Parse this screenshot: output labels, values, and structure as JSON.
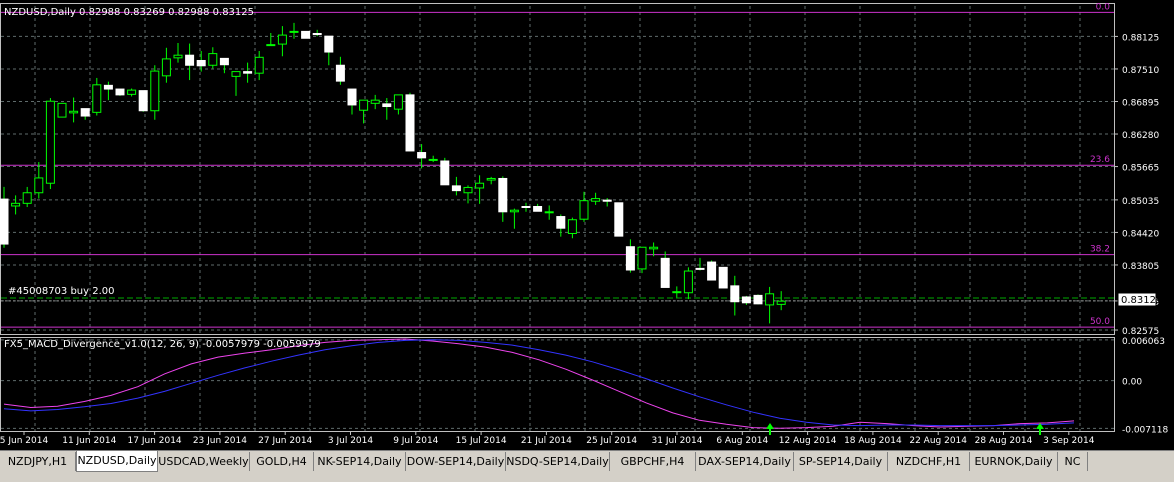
{
  "window": {
    "chart_title": "NZDUSD,Daily  0.82988 0.83269 0.82988 0.83125",
    "indicator_title": "FX5_MACD_Divergence_v1.0(12, 26, 9) -0.0057979 -0.0059979",
    "order_label": "#45008703 buy 2.00",
    "current_price": "0.83125"
  },
  "colors": {
    "background": "#000000",
    "grid": "#5f6b6b",
    "bull": "#00ff00",
    "bear": "#ffffff",
    "fib": "#cc33cc",
    "macd_main": "#ee44ee",
    "macd_signal": "#3333ff",
    "axis_text": "#ffffff"
  },
  "chart_data": [
    {
      "type": "candlestick",
      "title": "NZDUSD,Daily",
      "ylim": [
        0.825,
        0.887
      ],
      "y_ticks": [
        "0.88125",
        "0.87510",
        "0.86895",
        "0.86280",
        "0.85665",
        "0.85035",
        "0.84420",
        "0.83805",
        "0.83125",
        "0.82575"
      ],
      "x_ticks": [
        "5 Jun 2014",
        "11 Jun 2014",
        "17 Jun 2014",
        "23 Jun 2014",
        "27 Jun 2014",
        "3 Jul 2014",
        "9 Jul 2014",
        "15 Jul 2014",
        "21 Jul 2014",
        "25 Jul 2014",
        "31 Jul 2014",
        "6 Aug 2014",
        "12 Aug 2014",
        "18 Aug 2014",
        "22 Aug 2014",
        "28 Aug 2014",
        "3 Sep 2014"
      ],
      "fib_levels": [
        {
          "label": "0.0",
          "price": 0.8858
        },
        {
          "label": "23.6",
          "price": 0.8569
        },
        {
          "label": "38.2",
          "price": 0.84
        },
        {
          "label": "50.0",
          "price": 0.8263
        }
      ],
      "order_price": 0.8318,
      "current_price": 0.83125,
      "candles": [
        {
          "o": 0.8505,
          "h": 0.8528,
          "l": 0.8413,
          "c": 0.842
        },
        {
          "o": 0.8492,
          "h": 0.8512,
          "l": 0.8476,
          "c": 0.8497
        },
        {
          "o": 0.8497,
          "h": 0.8528,
          "l": 0.849,
          "c": 0.8517
        },
        {
          "o": 0.8517,
          "h": 0.8575,
          "l": 0.8506,
          "c": 0.8545
        },
        {
          "o": 0.8535,
          "h": 0.8696,
          "l": 0.8524,
          "c": 0.869
        },
        {
          "o": 0.866,
          "h": 0.8687,
          "l": 0.866,
          "c": 0.8686
        },
        {
          "o": 0.8668,
          "h": 0.8697,
          "l": 0.865,
          "c": 0.8671
        },
        {
          "o": 0.8676,
          "h": 0.8676,
          "l": 0.8655,
          "c": 0.8662
        },
        {
          "o": 0.8669,
          "h": 0.8734,
          "l": 0.8663,
          "c": 0.8721
        },
        {
          "o": 0.872,
          "h": 0.8727,
          "l": 0.8692,
          "c": 0.8713
        },
        {
          "o": 0.8713,
          "h": 0.8713,
          "l": 0.87,
          "c": 0.8702
        },
        {
          "o": 0.8703,
          "h": 0.8714,
          "l": 0.8699,
          "c": 0.8711
        },
        {
          "o": 0.871,
          "h": 0.8706,
          "l": 0.867,
          "c": 0.8672
        },
        {
          "o": 0.8672,
          "h": 0.8758,
          "l": 0.8655,
          "c": 0.8747
        },
        {
          "o": 0.8738,
          "h": 0.8791,
          "l": 0.8725,
          "c": 0.877
        },
        {
          "o": 0.8772,
          "h": 0.88,
          "l": 0.8763,
          "c": 0.8777
        },
        {
          "o": 0.8777,
          "h": 0.8799,
          "l": 0.873,
          "c": 0.8758
        },
        {
          "o": 0.8767,
          "h": 0.8785,
          "l": 0.8746,
          "c": 0.8757
        },
        {
          "o": 0.8758,
          "h": 0.8792,
          "l": 0.8752,
          "c": 0.878
        },
        {
          "o": 0.8771,
          "h": 0.8771,
          "l": 0.8743,
          "c": 0.8759
        },
        {
          "o": 0.8737,
          "h": 0.8742,
          "l": 0.87,
          "c": 0.8746
        },
        {
          "o": 0.8746,
          "h": 0.8763,
          "l": 0.8725,
          "c": 0.8743
        },
        {
          "o": 0.8743,
          "h": 0.8785,
          "l": 0.873,
          "c": 0.8773
        },
        {
          "o": 0.8797,
          "h": 0.8819,
          "l": 0.8797,
          "c": 0.8797
        },
        {
          "o": 0.8798,
          "h": 0.8832,
          "l": 0.8775,
          "c": 0.8815
        },
        {
          "o": 0.8821,
          "h": 0.8838,
          "l": 0.8808,
          "c": 0.8822
        },
        {
          "o": 0.8822,
          "h": 0.8822,
          "l": 0.8809,
          "c": 0.8809
        },
        {
          "o": 0.8818,
          "h": 0.8825,
          "l": 0.8813,
          "c": 0.8816
        },
        {
          "o": 0.8813,
          "h": 0.8813,
          "l": 0.8758,
          "c": 0.8783
        },
        {
          "o": 0.8758,
          "h": 0.8774,
          "l": 0.8721,
          "c": 0.8728
        },
        {
          "o": 0.8713,
          "h": 0.8713,
          "l": 0.8665,
          "c": 0.8683
        },
        {
          "o": 0.8673,
          "h": 0.8689,
          "l": 0.8648,
          "c": 0.8692
        },
        {
          "o": 0.8686,
          "h": 0.8702,
          "l": 0.8675,
          "c": 0.8692
        },
        {
          "o": 0.8685,
          "h": 0.8696,
          "l": 0.8655,
          "c": 0.868
        },
        {
          "o": 0.8675,
          "h": 0.87,
          "l": 0.8665,
          "c": 0.8702
        },
        {
          "o": 0.8702,
          "h": 0.8706,
          "l": 0.8595,
          "c": 0.8596
        },
        {
          "o": 0.8593,
          "h": 0.8609,
          "l": 0.8563,
          "c": 0.8583
        },
        {
          "o": 0.858,
          "h": 0.8587,
          "l": 0.8575,
          "c": 0.858
        },
        {
          "o": 0.8577,
          "h": 0.8583,
          "l": 0.8533,
          "c": 0.8532
        },
        {
          "o": 0.853,
          "h": 0.8547,
          "l": 0.8512,
          "c": 0.8521
        },
        {
          "o": 0.8517,
          "h": 0.8531,
          "l": 0.8497,
          "c": 0.8527
        },
        {
          "o": 0.8526,
          "h": 0.855,
          "l": 0.8496,
          "c": 0.8535
        },
        {
          "o": 0.8541,
          "h": 0.8547,
          "l": 0.8533,
          "c": 0.8544
        },
        {
          "o": 0.8544,
          "h": 0.8548,
          "l": 0.8462,
          "c": 0.8481
        },
        {
          "o": 0.8481,
          "h": 0.8487,
          "l": 0.8449,
          "c": 0.8484
        },
        {
          "o": 0.8491,
          "h": 0.8498,
          "l": 0.8481,
          "c": 0.849
        },
        {
          "o": 0.8491,
          "h": 0.8496,
          "l": 0.8482,
          "c": 0.8482
        },
        {
          "o": 0.848,
          "h": 0.8493,
          "l": 0.8466,
          "c": 0.8481
        },
        {
          "o": 0.8472,
          "h": 0.8476,
          "l": 0.8434,
          "c": 0.845
        },
        {
          "o": 0.844,
          "h": 0.847,
          "l": 0.8431,
          "c": 0.8466
        },
        {
          "o": 0.8467,
          "h": 0.8519,
          "l": 0.8462,
          "c": 0.8502
        },
        {
          "o": 0.8501,
          "h": 0.8517,
          "l": 0.8494,
          "c": 0.8506
        },
        {
          "o": 0.8503,
          "h": 0.8507,
          "l": 0.8491,
          "c": 0.8501
        },
        {
          "o": 0.8498,
          "h": 0.8496,
          "l": 0.8435,
          "c": 0.8435
        },
        {
          "o": 0.8415,
          "h": 0.8429,
          "l": 0.8366,
          "c": 0.8371
        },
        {
          "o": 0.8373,
          "h": 0.8411,
          "l": 0.8365,
          "c": 0.8414
        },
        {
          "o": 0.8411,
          "h": 0.8423,
          "l": 0.8397,
          "c": 0.8414
        },
        {
          "o": 0.8393,
          "h": 0.8406,
          "l": 0.8339,
          "c": 0.8338
        },
        {
          "o": 0.833,
          "h": 0.834,
          "l": 0.8319,
          "c": 0.833
        },
        {
          "o": 0.8328,
          "h": 0.8376,
          "l": 0.8316,
          "c": 0.8369
        },
        {
          "o": 0.8374,
          "h": 0.8394,
          "l": 0.837,
          "c": 0.8373
        },
        {
          "o": 0.8386,
          "h": 0.8389,
          "l": 0.8365,
          "c": 0.8352
        },
        {
          "o": 0.8376,
          "h": 0.8376,
          "l": 0.8339,
          "c": 0.8337
        },
        {
          "o": 0.8341,
          "h": 0.836,
          "l": 0.8285,
          "c": 0.8311
        },
        {
          "o": 0.832,
          "h": 0.8322,
          "l": 0.8305,
          "c": 0.8309
        },
        {
          "o": 0.8323,
          "h": 0.8325,
          "l": 0.8306,
          "c": 0.8307
        },
        {
          "o": 0.8305,
          "h": 0.8339,
          "l": 0.827,
          "c": 0.8326
        },
        {
          "o": 0.8306,
          "h": 0.8331,
          "l": 0.8295,
          "c": 0.8312
        }
      ]
    },
    {
      "type": "line",
      "title": "FX5_MACD_Divergence_v1.0(12, 26, 9)",
      "ylim": [
        -0.0075,
        0.0065
      ],
      "y_ticks": [
        "0.006063",
        "0.00",
        "-0.007118"
      ],
      "series": [
        {
          "values": [
            -0.0035,
            -0.004,
            -0.0038,
            -0.0031,
            -0.0022,
            -0.0009,
            0.001,
            0.0025,
            0.0035,
            0.0041,
            0.0046,
            0.0052,
            0.0057,
            0.006,
            0.0061,
            0.0062,
            0.0059,
            0.0055,
            0.005,
            0.0042,
            0.0031,
            0.0017,
            0.0001,
            -0.0016,
            -0.0033,
            -0.0048,
            -0.0059,
            -0.0065,
            -0.007,
            -0.0071,
            -0.007,
            -0.0068,
            -0.0062,
            -0.0064,
            -0.0067,
            -0.0069,
            -0.0068,
            -0.0067,
            -0.0064,
            -0.0063,
            -0.006
          ]
        },
        {
          "values": [
            -0.0042,
            -0.0045,
            -0.0043,
            -0.0039,
            -0.0034,
            -0.0026,
            -0.0016,
            -0.0004,
            0.0008,
            0.0019,
            0.0029,
            0.0038,
            0.0046,
            0.0052,
            0.0057,
            0.006,
            0.0061,
            0.006,
            0.0057,
            0.0053,
            0.0046,
            0.0038,
            0.0028,
            0.0016,
            0.0003,
            -0.0011,
            -0.0024,
            -0.0036,
            -0.0047,
            -0.0056,
            -0.0062,
            -0.0066,
            -0.0067,
            -0.0066,
            -0.0066,
            -0.0067,
            -0.0067,
            -0.0067,
            -0.0066,
            -0.0065,
            -0.0063
          ]
        }
      ]
    }
  ],
  "tabs": [
    {
      "label": "NZDJPY,H1",
      "active": false
    },
    {
      "label": "NZDUSD,Daily",
      "active": true
    },
    {
      "label": "USDCAD,Weekly",
      "active": false
    },
    {
      "label": "GOLD,H4",
      "active": false
    },
    {
      "label": "NK-SEP14,Daily",
      "active": false
    },
    {
      "label": "DOW-SEP14,Daily",
      "active": false
    },
    {
      "label": "NSDQ-SEP14,Daily",
      "active": false
    },
    {
      "label": "GBPCHF,H4",
      "active": false
    },
    {
      "label": "DAX-SEP14,Daily",
      "active": false
    },
    {
      "label": "SP-SEP14,Daily",
      "active": false
    },
    {
      "label": "NZDCHF,H1",
      "active": false
    },
    {
      "label": "EURNOK,Daily",
      "active": false
    },
    {
      "label": "NC",
      "active": false
    }
  ]
}
